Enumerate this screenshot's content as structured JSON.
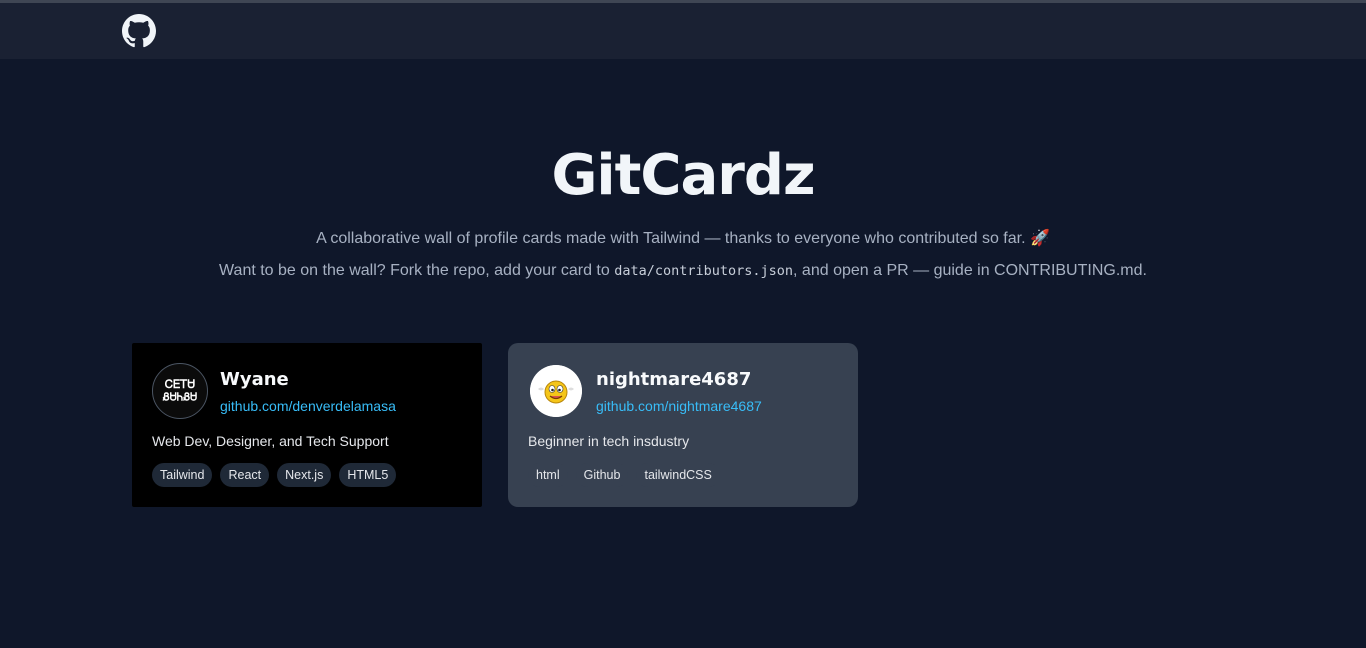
{
  "navbar": {
    "github_icon": "github-icon"
  },
  "hero": {
    "title": "GitCardz",
    "subtitle_line1": "A collaborative wall of profile cards made with Tailwind — thanks to everyone who contributed so far. 🚀",
    "subtitle_line2_before": "Want to be on the wall? Fork the repo, add your card to ",
    "subtitle_line2_code": "data/contributors.json",
    "subtitle_line2_after": ", and open a PR — guide in CONTRIBUTING.md."
  },
  "cards": [
    {
      "name": "Wyane",
      "url": "github.com/denverdelamasa",
      "bio": "Web Dev, Designer, and Tech Support",
      "tags": [
        "Tailwind",
        "React",
        "Next.js",
        "HTML5"
      ],
      "avatar_text": [
        "ᏟᎬᎢᏌ",
        "ᏰᏌᏂᏰᏌ"
      ]
    },
    {
      "name": "nightmare4687",
      "url": "github.com/nightmare4687",
      "bio": "Beginner in tech insdustry",
      "tags": [
        "html",
        "Github",
        "tailwindCSS"
      ]
    }
  ]
}
